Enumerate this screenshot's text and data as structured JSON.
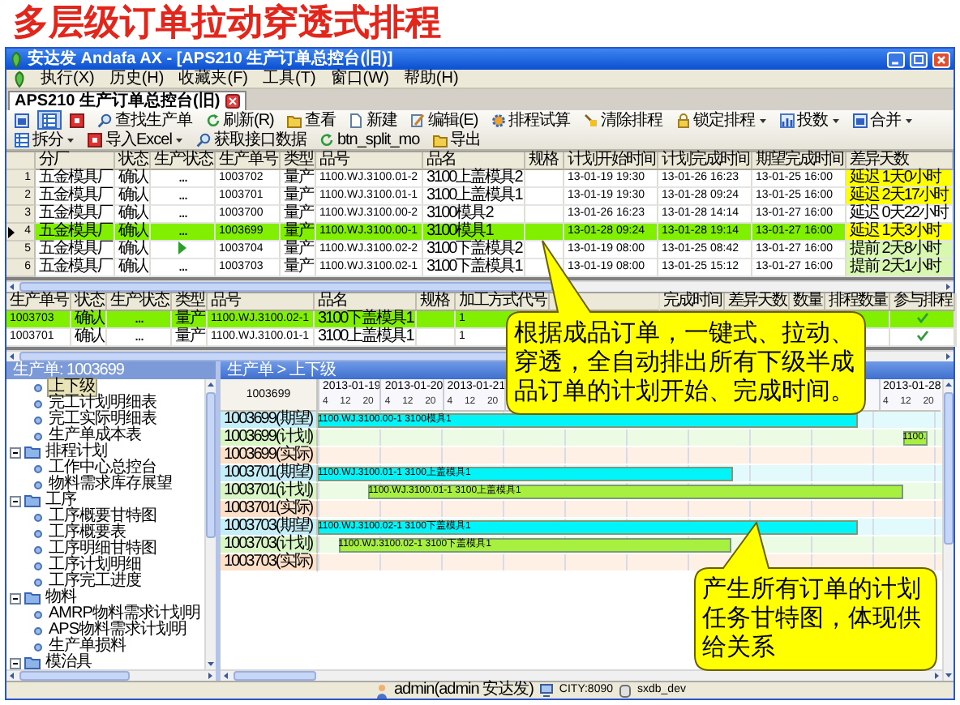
{
  "slide_title": "多层级订单拉动穿透式排程",
  "window": {
    "title": "安达发 Andafa AX - [APS210 生产订单总控台(旧)]"
  },
  "menu": [
    "执行(X)",
    "历史(H)",
    "收藏夹(F)",
    "工具(T)",
    "窗口(W)",
    "帮助(H)"
  ],
  "tabs": [
    {
      "label": "APS210 生产订单总控台(旧)",
      "selected": true
    }
  ],
  "toolbar": [
    {
      "kind": "icon",
      "pressed": false
    },
    {
      "kind": "icon",
      "pressed": true
    },
    {
      "kind": "icon",
      "pressed": false
    },
    {
      "kind": "button",
      "label": "查找生产单",
      "dropdown": false,
      "pressed": false
    },
    {
      "kind": "button",
      "label": "刷新(R)",
      "dropdown": false,
      "pressed": false
    },
    {
      "kind": "button",
      "label": "查看",
      "dropdown": false,
      "pressed": false
    },
    {
      "kind": "button",
      "label": "新建",
      "dropdown": false,
      "pressed": false
    },
    {
      "kind": "button",
      "label": "编辑(E)",
      "dropdown": false,
      "pressed": false
    },
    {
      "kind": "button",
      "label": "排程试算",
      "dropdown": false,
      "pressed": false
    },
    {
      "kind": "button",
      "label": "清除排程",
      "dropdown": false,
      "pressed": false
    },
    {
      "kind": "button",
      "label": "锁定排程",
      "dropdown": true,
      "pressed": false
    },
    {
      "kind": "button",
      "label": "投数",
      "dropdown": true,
      "pressed": false
    },
    {
      "kind": "button",
      "label": "合并",
      "dropdown": true,
      "pressed": false
    },
    {
      "kind": "button",
      "label": "拆分",
      "dropdown": true,
      "pressed": false
    },
    {
      "kind": "button",
      "label": "导入Excel",
      "dropdown": true,
      "pressed": false
    },
    {
      "kind": "button",
      "label": "获取接口数据",
      "dropdown": false,
      "pressed": false
    },
    {
      "kind": "button",
      "label": "btn_split_mo",
      "dropdown": false,
      "pressed": false
    },
    {
      "kind": "button",
      "label": "导出",
      "dropdown": false,
      "pressed": false
    }
  ],
  "order_grid": {
    "columns": [
      "分厂",
      "状态",
      "生产状态",
      "生产单号",
      "类型",
      "品号",
      "品名",
      "规格",
      "计划开始时间",
      "计划完成时间",
      "期望完成时间",
      "差异天数"
    ],
    "rows": [
      {
        "number": "1",
        "current": false,
        "selected": false,
        "factory": "五金模具厂",
        "status": "确认",
        "production_running": false,
        "production_state": "...",
        "order_no": "1003702",
        "type": "量产",
        "item_no": "1100.WJ.3100.01-2",
        "item_name": "3100上盖模具2",
        "plan_start": "13-01-19 19:30",
        "plan_finish": "13-01-26 16:23",
        "expected_finish": "13-01-25 16:00",
        "variance": "延迟 1天0小时",
        "color": "#ffff00"
      },
      {
        "number": "2",
        "current": false,
        "selected": false,
        "factory": "五金模具厂",
        "status": "确认",
        "production_running": false,
        "production_state": "...",
        "order_no": "1003701",
        "type": "量产",
        "item_no": "1100.WJ.3100.01-1",
        "item_name": "3100上盖模具1",
        "plan_start": "13-01-19 19:30",
        "plan_finish": "13-01-28 09:24",
        "expected_finish": "13-01-25 16:00",
        "variance": "延迟 2天17小时",
        "color": "#ffff00"
      },
      {
        "number": "3",
        "current": false,
        "selected": false,
        "factory": "五金模具厂",
        "status": "确认",
        "production_running": false,
        "production_state": "...",
        "order_no": "1003700",
        "type": "量产",
        "item_no": "1100.WJ.3100.00-2",
        "item_name": "3100模具2",
        "plan_start": "13-01-26 16:23",
        "plan_finish": "13-01-28 14:14",
        "expected_finish": "13-01-27 16:00",
        "variance": "延迟 0天22小时",
        "color": "#ffffff"
      },
      {
        "number": "4",
        "current": true,
        "selected": true,
        "factory": "五金模具厂",
        "status": "确认",
        "production_running": false,
        "production_state": "...",
        "order_no": "1003699",
        "type": "量产",
        "item_no": "1100.WJ.3100.00-1",
        "item_name": "3100模具1",
        "plan_start": "13-01-28 09:24",
        "plan_finish": "13-01-28 19:14",
        "expected_finish": "13-01-27 16:00",
        "variance": "延迟 1天3小时",
        "color": "#ffff00"
      },
      {
        "number": "5",
        "current": false,
        "selected": false,
        "factory": "五金模具厂",
        "status": "确认",
        "production_running": true,
        "order_no": "1003704",
        "type": "量产",
        "item_no": "1100.WJ.3100.02-2",
        "item_name": "3100下盖模具2",
        "plan_start": "13-01-19 08:00",
        "plan_finish": "13-01-25 08:42",
        "expected_finish": "13-01-27 16:00",
        "variance": "提前 2天8小时",
        "color": "#d8f8b0"
      },
      {
        "number": "6",
        "current": false,
        "selected": false,
        "factory": "五金模具厂",
        "status": "确认",
        "production_running": false,
        "production_state": "...",
        "order_no": "1003703",
        "type": "量产",
        "item_no": "1100.WJ.3100.02-1",
        "item_name": "3100下盖模具1",
        "plan_start": "13-01-19 08:00",
        "plan_finish": "13-01-25 15:12",
        "expected_finish": "13-01-27 16:00",
        "variance": "提前 2天1小时",
        "color": "#d8f8b0"
      }
    ]
  },
  "sub_grid": {
    "columns": [
      "生产单号",
      "状态",
      "生产状态",
      "类型",
      "品号",
      "品名",
      "规格",
      "加工方式代号",
      "完成时间",
      "差异天数",
      "数量",
      "排程数量",
      "参与排程"
    ],
    "rows": [
      {
        "selected": true,
        "order_no": "1003703",
        "status": "确认",
        "production_state": "...",
        "type": "量产",
        "item_no": "1100.WJ.3100.02-1",
        "item_name": "3100下盖模具1",
        "process_code": "1",
        "scheduled": true
      },
      {
        "selected": false,
        "order_no": "1003701",
        "status": "确认",
        "production_state": "...",
        "type": "量产",
        "item_no": "1100.WJ.3100.01-1",
        "item_name": "3100上盖模具1",
        "process_code": "1",
        "scheduled": true
      }
    ]
  },
  "tree": {
    "header": "生产单: 1003699",
    "items": [
      {
        "label": "上下级",
        "kind": "leaf",
        "selected": true
      },
      {
        "label": "完工计划明细表",
        "kind": "leaf",
        "selected": false
      },
      {
        "label": "完工实际明细表",
        "kind": "leaf",
        "selected": false
      },
      {
        "label": "生产单成本表",
        "kind": "leaf",
        "selected": false
      },
      {
        "label": "排程计划",
        "kind": "folder",
        "expanded": true,
        "selected": false,
        "children": [
          {
            "label": "工作中心总控台",
            "kind": "leaf",
            "selected": false
          },
          {
            "label": "物料需求库存展望",
            "kind": "leaf",
            "selected": false
          }
        ]
      },
      {
        "label": "工序",
        "kind": "folder",
        "expanded": true,
        "selected": false,
        "children": [
          {
            "label": "工序概要甘特图",
            "kind": "leaf",
            "selected": false
          },
          {
            "label": "工序概要表",
            "kind": "leaf",
            "selected": false
          },
          {
            "label": "工序明细甘特图",
            "kind": "leaf",
            "selected": false
          },
          {
            "label": "工序计划明细",
            "kind": "leaf",
            "selected": false
          },
          {
            "label": "工序完工进度",
            "kind": "leaf",
            "selected": false
          }
        ]
      },
      {
        "label": "物料",
        "kind": "folder",
        "expanded": true,
        "selected": false,
        "children": [
          {
            "label": "AMRP物料需求计划明",
            "kind": "leaf",
            "selected": false
          },
          {
            "label": "APS物料需求计划明",
            "kind": "leaf",
            "selected": false
          },
          {
            "label": "生产单损料",
            "kind": "leaf",
            "selected": false
          }
        ]
      },
      {
        "label": "模治具",
        "kind": "folder",
        "expanded": true,
        "selected": false
      }
    ]
  },
  "gantt": {
    "header": "生产单 > 上下级",
    "corner": "1003699",
    "rows": [
      {
        "label": "1003699(期望)",
        "kind": "expected",
        "bar_text": "1100.WJ.3100.00-1  3100模具1"
      },
      {
        "label": "1003699(计划)",
        "kind": "plan",
        "bar_text": "1100."
      },
      {
        "label": "1003699(实际)",
        "kind": "actual"
      },
      {
        "label": "1003701(期望)",
        "kind": "expected",
        "bar_text": "1100.WJ.3100.01-1  3100上盖模具1"
      },
      {
        "label": "1003701(计划)",
        "kind": "plan",
        "bar_text": "1100.WJ.3100.01-1  3100上盖模具1"
      },
      {
        "label": "1003701(实际)",
        "kind": "actual"
      },
      {
        "label": "1003703(期望)",
        "kind": "expected",
        "bar_text": "1100.WJ.3100.02-1  3100下盖模具1"
      },
      {
        "label": "1003703(计划)",
        "kind": "plan",
        "bar_text": "1100.WJ.3100.02-1  3100下盖模具1"
      },
      {
        "label": "1003703(实际)",
        "kind": "actual"
      }
    ],
    "days_left": [
      {
        "date": "2013-01-19",
        "ticks": [
          "4",
          "12",
          "20"
        ]
      },
      {
        "date": "2013-01-20",
        "ticks": [
          "4",
          "12",
          "20"
        ]
      },
      {
        "date": "2013-01-21",
        "ticks": [
          "4",
          "12",
          "20"
        ]
      }
    ],
    "day_right": {
      "date": "2013-01-28",
      "ticks": [
        "4",
        "12",
        "20"
      ]
    }
  },
  "status_bar": [
    "admin(admin 安达发)",
    "CITY:8090",
    "sxdb_dev"
  ],
  "callouts": [
    "根据成品订单，一键式、拉动、穿透，全自动排出所有下级半成品订单的计划开始、完成时间。",
    "产生所有订单的计划任务甘特图，体现供给关系"
  ]
}
